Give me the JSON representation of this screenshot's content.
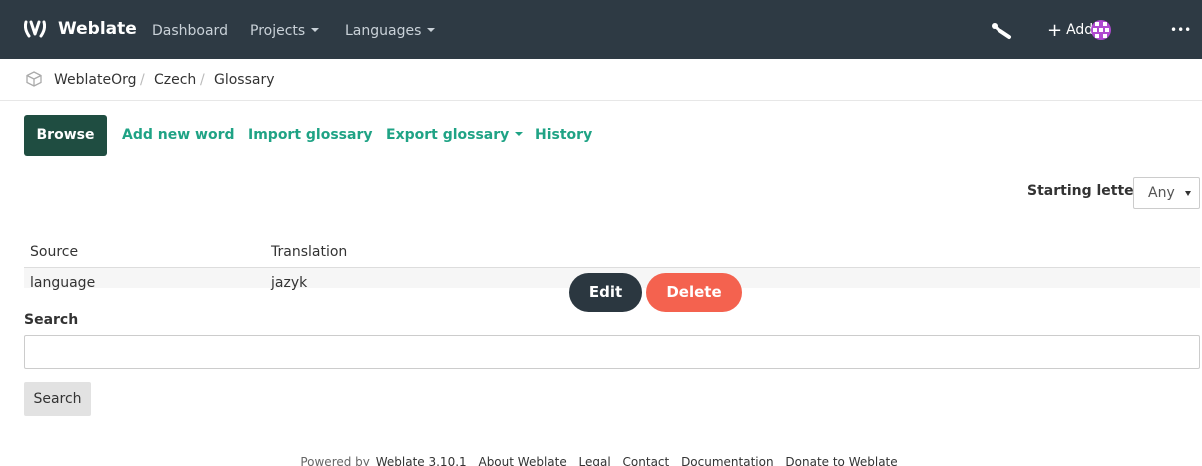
{
  "navbar": {
    "brand": "Weblate",
    "items": [
      {
        "label": "Dashboard",
        "dropdown": false
      },
      {
        "label": "Projects",
        "dropdown": true
      },
      {
        "label": "Languages",
        "dropdown": true
      }
    ],
    "tools_icon": "wrench-icon",
    "add_label": "Add",
    "more_label": "•••",
    "colors": {
      "background": "#2e3a44",
      "avatar": "#b04ad1"
    }
  },
  "breadcrumb": {
    "icon": "project-cube-icon",
    "items": [
      "WeblateOrg",
      "Czech",
      "Glossary"
    ],
    "separator": "/"
  },
  "tabs": {
    "active": "Browse",
    "items": [
      "Add new word",
      "Import glossary",
      "Export glossary",
      "History"
    ]
  },
  "filter": {
    "label": "Starting letter",
    "value": "Any"
  },
  "table": {
    "headers": [
      "Source",
      "Translation"
    ],
    "rows": [
      {
        "source": "language",
        "translation": "jazyk",
        "edit_label": "Edit",
        "delete_label": "Delete"
      }
    ]
  },
  "search": {
    "label": "Search",
    "value": "",
    "button_label": "Search"
  },
  "footer": {
    "prefix": "Powered by",
    "links": [
      "Weblate 3.10.1",
      "About Weblate",
      "Legal",
      "Contact",
      "Documentation",
      "Donate to Weblate"
    ]
  },
  "colors": {
    "accent": "#1fa385",
    "active_tab": "#1f4d41",
    "edit_button": "#2b3740",
    "delete_button": "#f4624f"
  }
}
